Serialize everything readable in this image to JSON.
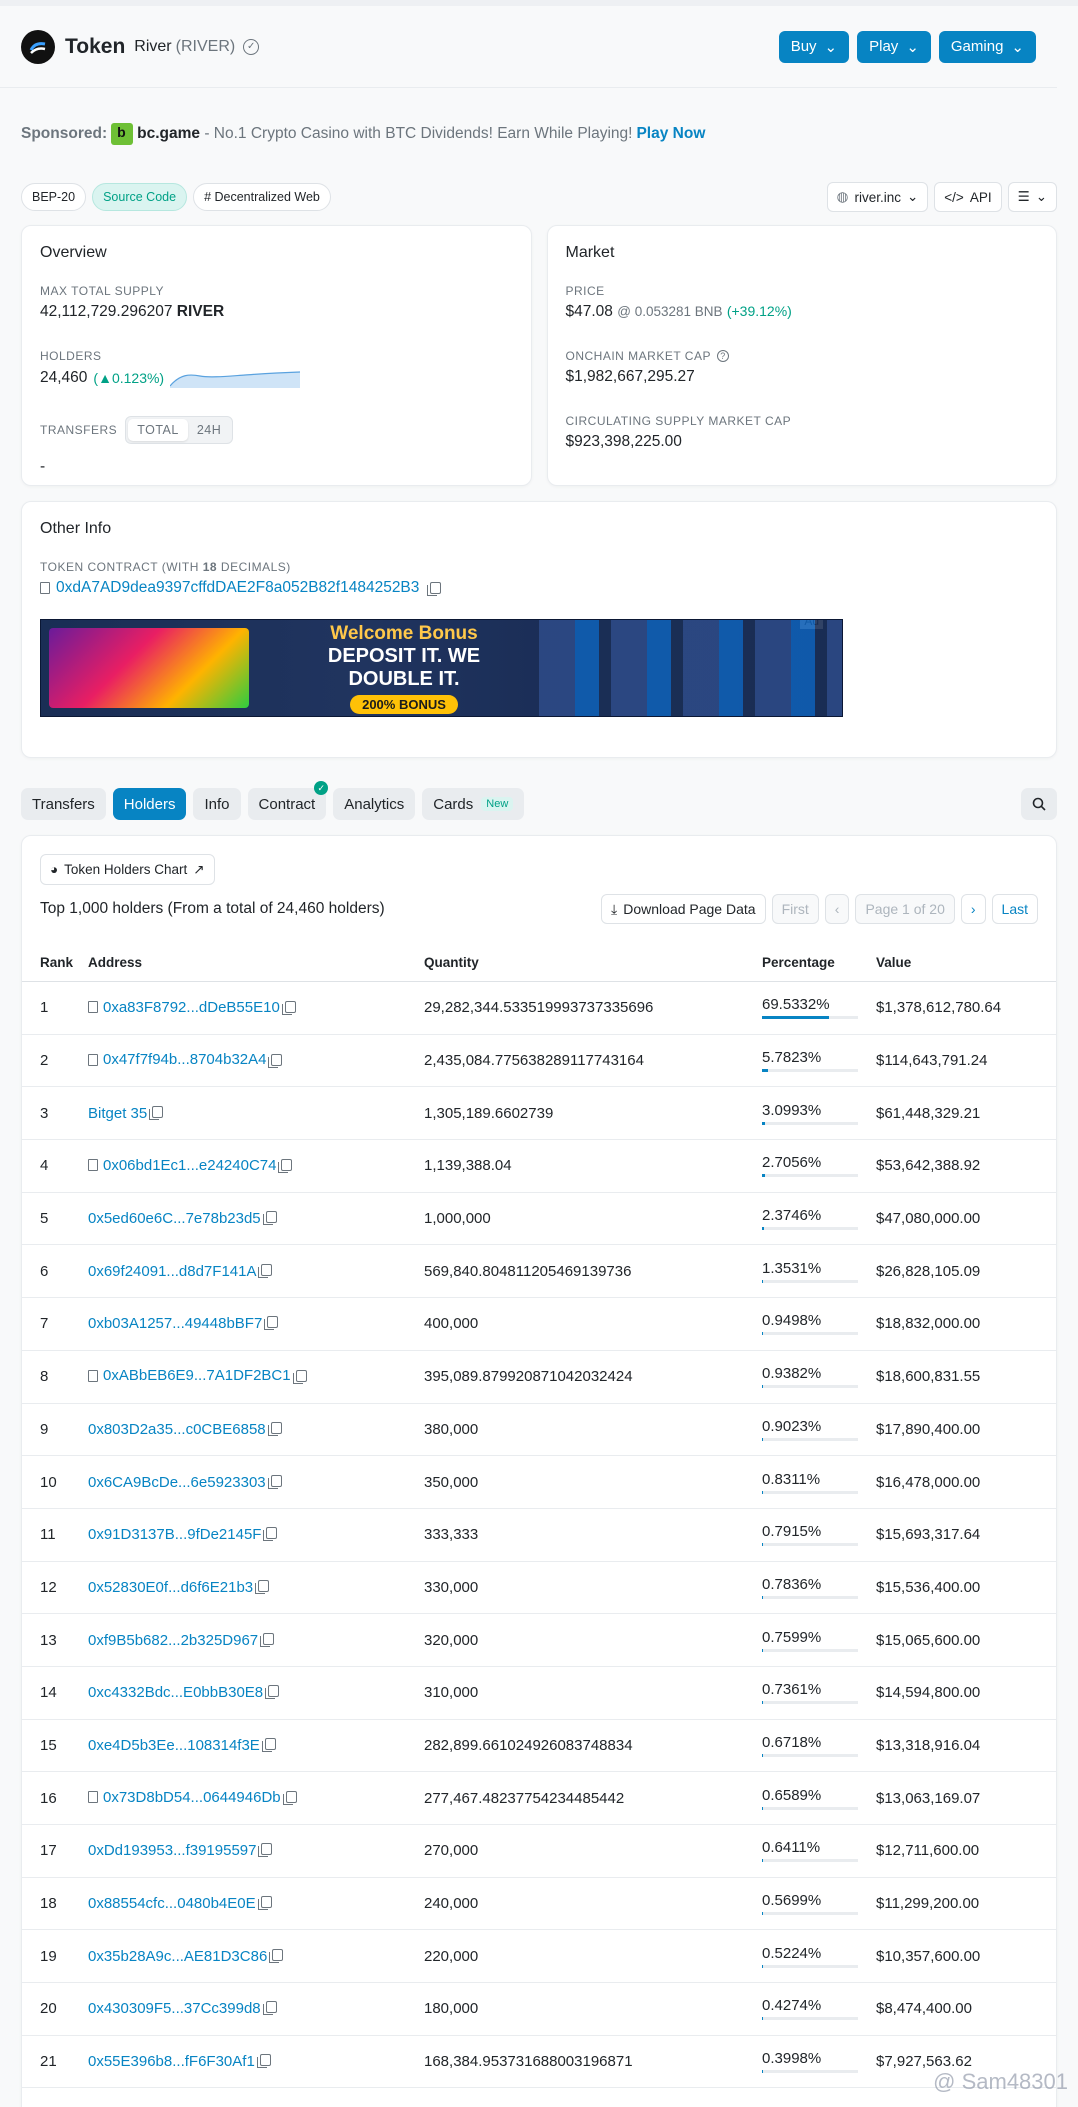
{
  "header": {
    "title": "Token",
    "name": "River",
    "symbol": "(RIVER)",
    "buttons": [
      "Buy",
      "Play",
      "Gaming"
    ]
  },
  "sponsor": {
    "prefix": "Sponsored:",
    "brand": "bc.game",
    "text": "- No.1 Crypto Casino with BTC Dividends! Earn While Playing!",
    "cta": "Play Now"
  },
  "tags": [
    "BEP-20",
    "Source Code",
    "# Decentralized Web"
  ],
  "tags_right": {
    "site": "river.inc",
    "api": "API"
  },
  "overview": {
    "title": "Overview",
    "max_supply_label": "MAX TOTAL SUPPLY",
    "max_supply": "42,112,729.296207",
    "max_supply_unit": "RIVER",
    "holders_label": "HOLDERS",
    "holders": "24,460",
    "holders_change": "0.123%)",
    "transfers_label": "TRANSFERS",
    "seg_total": "TOTAL",
    "seg_24h": "24H",
    "transfers_value": "-"
  },
  "market": {
    "title": "Market",
    "price_label": "PRICE",
    "price": "$47.08",
    "price_bnb": "@ 0.053281 BNB",
    "price_change": "(+39.12%)",
    "onchain_label": "ONCHAIN MARKET CAP",
    "onchain": "$1,982,667,295.27",
    "circ_label": "CIRCULATING SUPPLY MARKET CAP",
    "circ": "$923,398,225.00"
  },
  "other": {
    "title": "Other Info",
    "contract_label_a": "TOKEN CONTRACT (WITH ",
    "contract_label_b": "18",
    "contract_label_c": " DECIMALS)",
    "contract": "0xdA7AD9dea9397cffdDAE2F8a052B82f1484252B3",
    "ad_tag": "Ad",
    "ad_t1": "Welcome Bonus",
    "ad_t2": "DEPOSIT IT. WE DOUBLE IT.",
    "ad_t3": "200% BONUS"
  },
  "tabs": [
    "Transfers",
    "Holders",
    "Info",
    "Contract",
    "Analytics",
    "Cards"
  ],
  "tab_new": "New",
  "holders_table": {
    "chart_link": "Token Holders Chart",
    "summary": "Top 1,000 holders (From a total of 24,460 holders)",
    "download": "Download Page Data",
    "first": "First",
    "page": "Page 1 of 20",
    "last": "Last",
    "headers": [
      "Rank",
      "Address",
      "Quantity",
      "Percentage",
      "Value"
    ],
    "rows": [
      {
        "rank": "1",
        "addr": "0xa83F8792...dDeB55E10",
        "contract": true,
        "qty": "29,282,344.533519993737335696",
        "pct": "69.5332%",
        "pv": 69.5332,
        "value": "$1,378,612,780.64"
      },
      {
        "rank": "2",
        "addr": "0x47f7f94b...8704b32A4",
        "contract": true,
        "qty": "2,435,084.775638289117743164",
        "pct": "5.7823%",
        "pv": 5.7823,
        "value": "$114,643,791.24"
      },
      {
        "rank": "3",
        "addr": "Bitget 35",
        "contract": false,
        "qty": "1,305,189.6602739",
        "pct": "3.0993%",
        "pv": 3.0993,
        "value": "$61,448,329.21"
      },
      {
        "rank": "4",
        "addr": "0x06bd1Ec1...e24240C74",
        "contract": true,
        "qty": "1,139,388.04",
        "pct": "2.7056%",
        "pv": 2.7056,
        "value": "$53,642,388.92"
      },
      {
        "rank": "5",
        "addr": "0x5ed60e6C...7e78b23d5",
        "contract": false,
        "qty": "1,000,000",
        "pct": "2.3746%",
        "pv": 2.3746,
        "value": "$47,080,000.00"
      },
      {
        "rank": "6",
        "addr": "0x69f24091...d8d7F141A",
        "contract": false,
        "qty": "569,840.804811205469139736",
        "pct": "1.3531%",
        "pv": 1.3531,
        "value": "$26,828,105.09"
      },
      {
        "rank": "7",
        "addr": "0xb03A1257...49448bBF7",
        "contract": false,
        "qty": "400,000",
        "pct": "0.9498%",
        "pv": 0.9498,
        "value": "$18,832,000.00"
      },
      {
        "rank": "8",
        "addr": "0xABbEB6E9...7A1DF2BC1",
        "contract": true,
        "qty": "395,089.879920871042032424",
        "pct": "0.9382%",
        "pv": 0.9382,
        "value": "$18,600,831.55"
      },
      {
        "rank": "9",
        "addr": "0x803D2a35...c0CBE6858",
        "contract": false,
        "qty": "380,000",
        "pct": "0.9023%",
        "pv": 0.9023,
        "value": "$17,890,400.00"
      },
      {
        "rank": "10",
        "addr": "0x6CA9BcDe...6e5923303",
        "contract": false,
        "qty": "350,000",
        "pct": "0.8311%",
        "pv": 0.8311,
        "value": "$16,478,000.00"
      },
      {
        "rank": "11",
        "addr": "0x91D3137B...9fDe2145F",
        "contract": false,
        "qty": "333,333",
        "pct": "0.7915%",
        "pv": 0.7915,
        "value": "$15,693,317.64"
      },
      {
        "rank": "12",
        "addr": "0x52830E0f...d6f6E21b3",
        "contract": false,
        "qty": "330,000",
        "pct": "0.7836%",
        "pv": 0.7836,
        "value": "$15,536,400.00"
      },
      {
        "rank": "13",
        "addr": "0xf9B5b682...2b325D967",
        "contract": false,
        "qty": "320,000",
        "pct": "0.7599%",
        "pv": 0.7599,
        "value": "$15,065,600.00"
      },
      {
        "rank": "14",
        "addr": "0xc4332Bdc...E0bbB30E8",
        "contract": false,
        "qty": "310,000",
        "pct": "0.7361%",
        "pv": 0.7361,
        "value": "$14,594,800.00"
      },
      {
        "rank": "15",
        "addr": "0xe4D5b3Ee...108314f3E",
        "contract": false,
        "qty": "282,899.661024926083748834",
        "pct": "0.6718%",
        "pv": 0.6718,
        "value": "$13,318,916.04"
      },
      {
        "rank": "16",
        "addr": "0x73D8bD54...0644946Db",
        "contract": true,
        "qty": "277,467.48237754234485442",
        "pct": "0.6589%",
        "pv": 0.6589,
        "value": "$13,063,169.07"
      },
      {
        "rank": "17",
        "addr": "0xDd193953...f39195597",
        "contract": false,
        "qty": "270,000",
        "pct": "0.6411%",
        "pv": 0.6411,
        "value": "$12,711,600.00"
      },
      {
        "rank": "18",
        "addr": "0x88554cfc...0480b4E0E",
        "contract": false,
        "qty": "240,000",
        "pct": "0.5699%",
        "pv": 0.5699,
        "value": "$11,299,200.00"
      },
      {
        "rank": "19",
        "addr": "0x35b28A9c...AE81D3C86",
        "contract": false,
        "qty": "220,000",
        "pct": "0.5224%",
        "pv": 0.5224,
        "value": "$10,357,600.00"
      },
      {
        "rank": "20",
        "addr": "0x430309F5...37Cc399d8",
        "contract": false,
        "qty": "180,000",
        "pct": "0.4274%",
        "pv": 0.4274,
        "value": "$8,474,400.00"
      },
      {
        "rank": "21",
        "addr": "0x55E396b8...fF6F30Af1",
        "contract": false,
        "qty": "168,384.953731688003196871",
        "pct": "0.3998%",
        "pv": 0.3998,
        "value": "$7,927,563.62"
      }
    ]
  },
  "watermark": "@ Sam48301"
}
